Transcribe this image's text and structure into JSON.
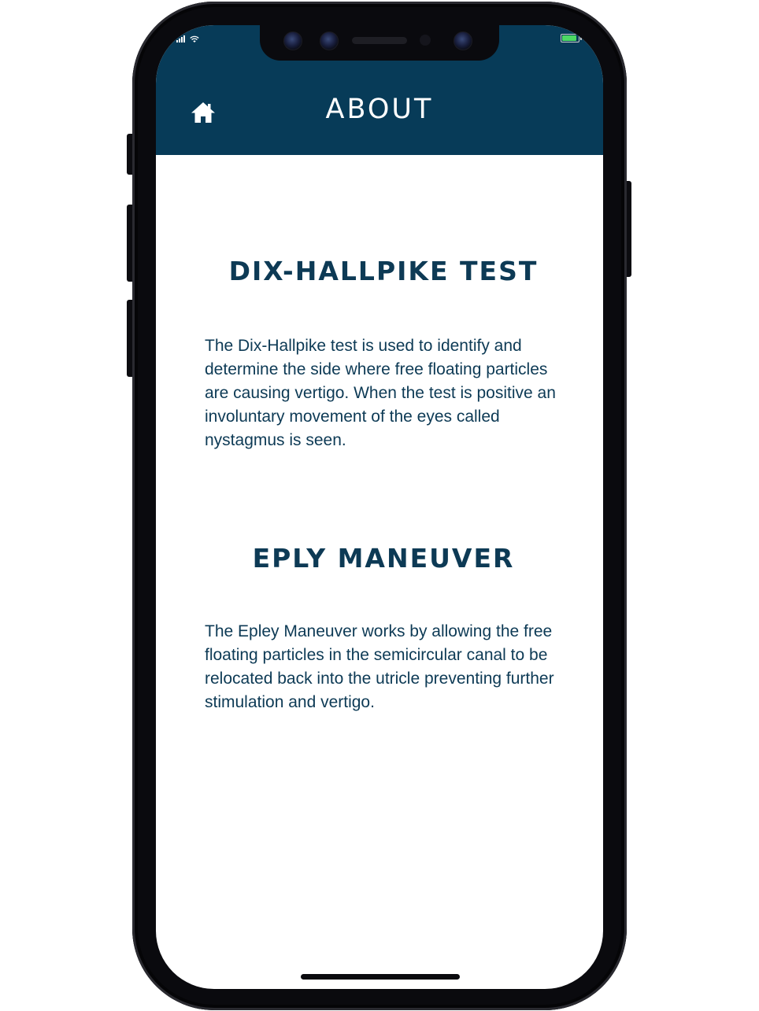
{
  "status_bar": {
    "signal_bars": 4,
    "wifi": "wifi-icon",
    "battery_level": 1.0,
    "charging": true,
    "battery_color": "#4cd964"
  },
  "header": {
    "title": "ABOUT",
    "home_icon": "home-icon",
    "background": "#073b58"
  },
  "sections": [
    {
      "title": "DIX-HALLPIKE TEST",
      "body": "The Dix-Hallpike test is used to identify and determine the side where free floating particles are causing vertigo. When the test is positive an involuntary movement of the eyes called nystagmus is seen."
    },
    {
      "title": "EPLY MANEUVER",
      "body": "The Epley Maneuver works by allowing the free floating particles in the semicircular canal to be relocated back into the utricle preventing further stimulation and vertigo."
    }
  ],
  "colors": {
    "text": "#0d3a55",
    "header": "#073b58"
  }
}
